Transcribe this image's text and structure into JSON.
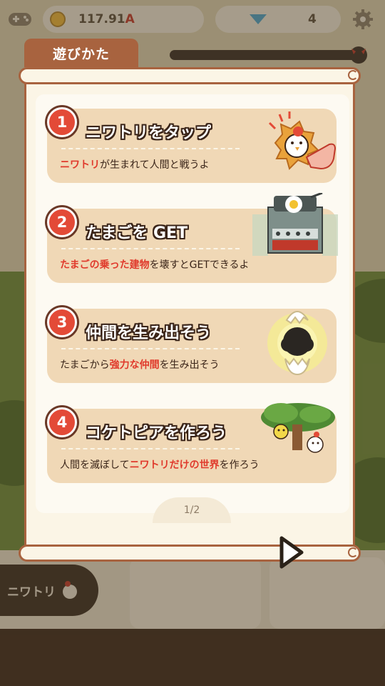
{
  "topbar": {
    "money_value": "117.91",
    "money_unit": "A",
    "gem_count": "4"
  },
  "bottom": {
    "chicken_button_label": "ニワトリ"
  },
  "progress": {
    "fraction": 0.0
  },
  "dialog": {
    "tab_title": "遊びかた",
    "steps": [
      {
        "number": "1",
        "title": "ニワトリをタップ",
        "desc": [
          {
            "text": "ニワトリ",
            "highlight": true
          },
          {
            "text": "が生まれて人間と戦うよ",
            "highlight": false
          }
        ]
      },
      {
        "number": "2",
        "title": "たまごを GET",
        "desc": [
          {
            "text": "たまごの乗った建物",
            "highlight": true
          },
          {
            "text": "を壊すとGETできるよ",
            "highlight": false
          }
        ]
      },
      {
        "number": "3",
        "title": "仲間を生み出そう",
        "desc": [
          {
            "text": "たまごから",
            "highlight": false
          },
          {
            "text": "強力な仲間",
            "highlight": true
          },
          {
            "text": "を生み出そう",
            "highlight": false
          }
        ]
      },
      {
        "number": "4",
        "title": "コケトピアを作ろう",
        "desc": [
          {
            "text": "人間を滅ぼして",
            "highlight": false
          },
          {
            "text": "ニワトリだけの世界",
            "highlight": true
          },
          {
            "text": "を作ろう",
            "highlight": false
          }
        ]
      }
    ],
    "page_indicator": "1/2"
  },
  "colors": {
    "accent_red": "#e03a2c",
    "card_bg": "#f0d8b6",
    "frame_brown": "#a8633f",
    "paper": "#fbf5e6"
  },
  "icons": {
    "settings": "gear-icon",
    "controller": "gamepad-icon",
    "coin": "coin-icon",
    "gem": "diamond-icon",
    "next": "next-arrow-icon"
  }
}
